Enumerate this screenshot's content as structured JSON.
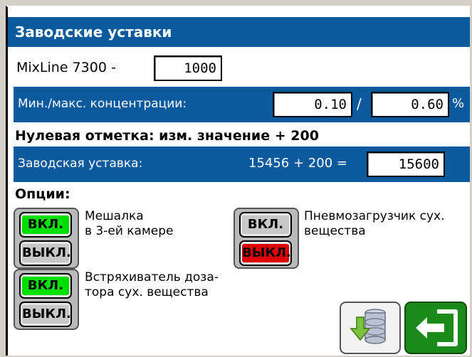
{
  "title": "Заводские уставки",
  "mixline": {
    "label": "MixLine 7300 -",
    "value": "1000"
  },
  "concentration": {
    "label": "Мин./макс. концентрации:",
    "min": "0.10",
    "separator": "/",
    "max": "0.60",
    "unit": "%"
  },
  "zero_mark": {
    "text": "Нулевая отметка: изм. значение + 200"
  },
  "factory_setting": {
    "label": "Заводская уставка:",
    "expression": "15456 + 200 =",
    "value": "15600"
  },
  "options": {
    "title": "Опции:",
    "items": [
      {
        "on_label": "ВКЛ.",
        "off_label": "ВЫКЛ.",
        "state": "on",
        "line1": "Мешалка",
        "line2": "в 3-ей камере"
      },
      {
        "on_label": "ВКЛ.",
        "off_label": "ВЫКЛ.",
        "state": "off",
        "line1": "Пневмозагрузчик сух.",
        "line2": "вещества"
      },
      {
        "on_label": "ВКЛ.",
        "off_label": "ВЫКЛ.",
        "state": "on",
        "line1": "Встряхиватель доза-",
        "line2": "тора сух. вещества"
      }
    ]
  },
  "icons": {
    "database": "database-download-icon",
    "exit": "exit-icon"
  },
  "colors": {
    "header_blue": "#0b5a9e",
    "on_green": "#00e000",
    "off_red": "#e00000",
    "exit_green": "#1a8a1a"
  }
}
